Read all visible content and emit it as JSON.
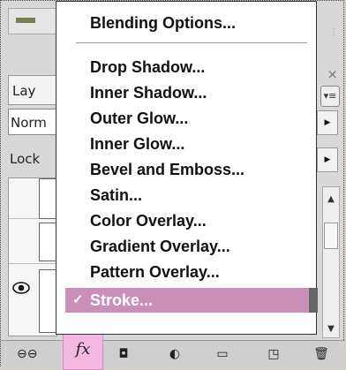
{
  "panel": {
    "tab_label": "Lay",
    "blend_mode": "Norm",
    "lock_label": "Lock",
    "panel_menu_icon": "panel-menu-icon",
    "close_icon": "close-icon"
  },
  "context_menu": {
    "header": "Blending Options...",
    "items": [
      "Drop Shadow...",
      "Inner Shadow...",
      "Outer Glow...",
      "Inner Glow...",
      "Bevel and Emboss...",
      "Satin...",
      "Color Overlay...",
      "Gradient Overlay...",
      "Pattern Overlay...",
      "Stroke..."
    ],
    "selected": "Stroke...",
    "selected_check": "✓"
  },
  "bottom_toolbar": {
    "fx_label": "fx"
  },
  "colors": {
    "highlight": "#c98fb7",
    "fx_button": "#f2b8e0",
    "menu_bg": "#ffffff"
  }
}
